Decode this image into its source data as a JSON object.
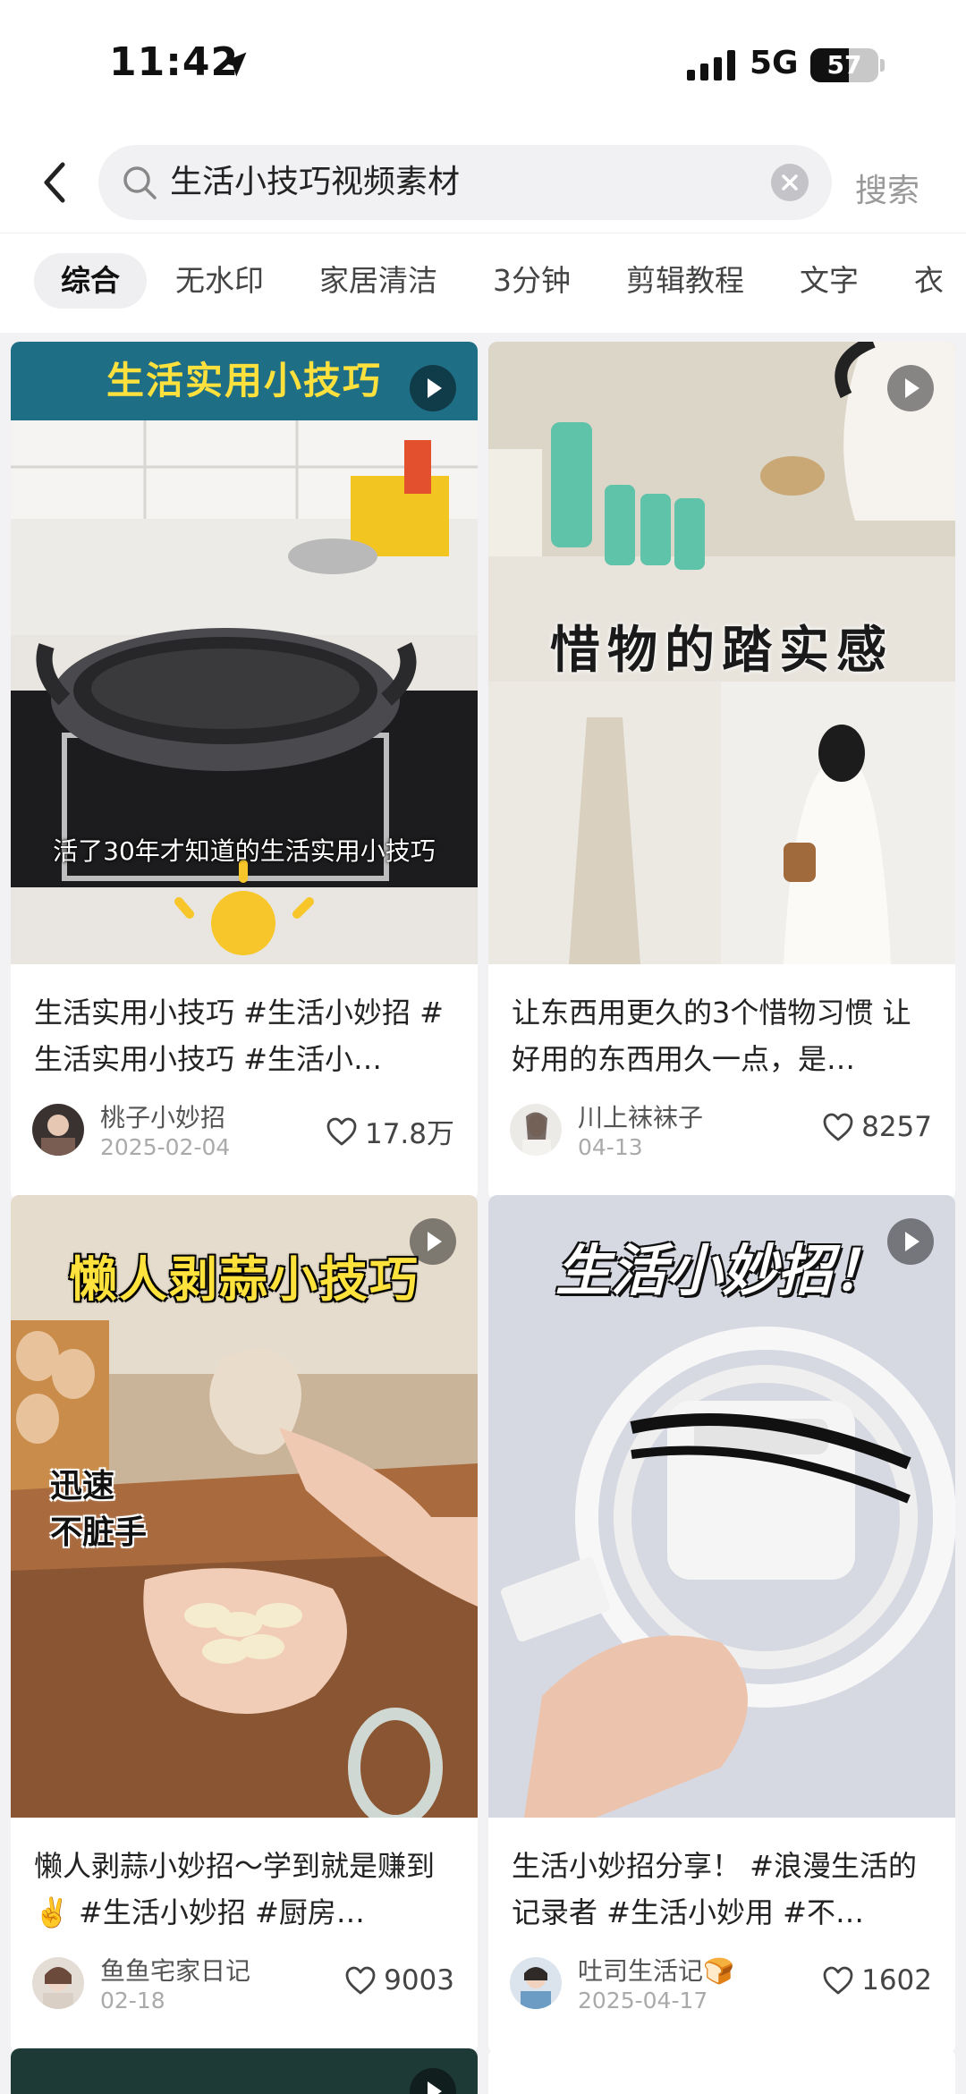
{
  "status_bar": {
    "time": "11:42",
    "network": "5G",
    "battery_text": "57",
    "battery_level_percent": 57
  },
  "search": {
    "query": "生活小技巧视频素材",
    "button_label": "搜索"
  },
  "filters": {
    "tabs": [
      "综合",
      "无水印",
      "家居清洁",
      "3分钟",
      "剪辑教程",
      "文字",
      "衣"
    ],
    "active_index": 0
  },
  "colors": {
    "accent_teal": "#1e6e86",
    "caption_yellow": "#ffe13d",
    "page_bg": "#f2f2f4"
  },
  "feed": {
    "cards": [
      {
        "thumb_banner": "生活实用小技巧",
        "thumb_caption": "活了30年才知道的生活实用小技巧",
        "title": "生活实用小技巧 #生活小妙招 #生活实用小技巧 #生活小…",
        "author": "桃子小妙招",
        "date": "2025-02-04",
        "likes": "17.8万"
      },
      {
        "thumb_title": "惜物的踏实感",
        "title": "让东西用更久的3个惜物习惯 让好用的东西用久一点，是…",
        "author": "川上袜袜子",
        "date": "04-13",
        "likes": "8257"
      },
      {
        "thumb_title": "懒人剥蒜小技巧",
        "thumb_sticker": "迅速\n不脏手",
        "title": "懒人剥蒜小妙招～学到就是赚到✌️ #生活小妙招 #厨房…",
        "author": "鱼鱼宅家日记",
        "date": "02-18",
        "likes": "9003"
      },
      {
        "thumb_title": "生活小妙招！",
        "title": "生活小妙招分享！ #浪漫生活的记录者 #生活小妙用 #不…",
        "author": "吐司生活记🍞",
        "date": "2025-04-17",
        "likes": "1602"
      }
    ]
  }
}
